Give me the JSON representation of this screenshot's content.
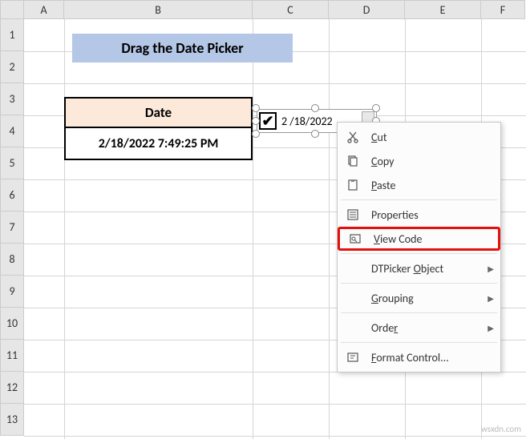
{
  "columns": [
    "A",
    "B",
    "C",
    "D",
    "E",
    "F"
  ],
  "rows": [
    "1",
    "2",
    "3",
    "4",
    "5",
    "6",
    "7",
    "8",
    "9",
    "10",
    "11",
    "12",
    "13"
  ],
  "title": "Drag the Date Picker",
  "table": {
    "header": "Date",
    "value": "2/18/2022  7:49:25 PM"
  },
  "dtpicker": {
    "value": "2 /18/2022",
    "check_glyph": "✔"
  },
  "menu": {
    "cut": "Cut",
    "copy": "Copy",
    "paste": "Paste",
    "properties": "Properties",
    "view_code": "View Code",
    "dtpicker_object": "DTPicker Object",
    "grouping": "Grouping",
    "order": "Order",
    "format_control": "Format Control..."
  },
  "watermark": "wsxdn.com"
}
